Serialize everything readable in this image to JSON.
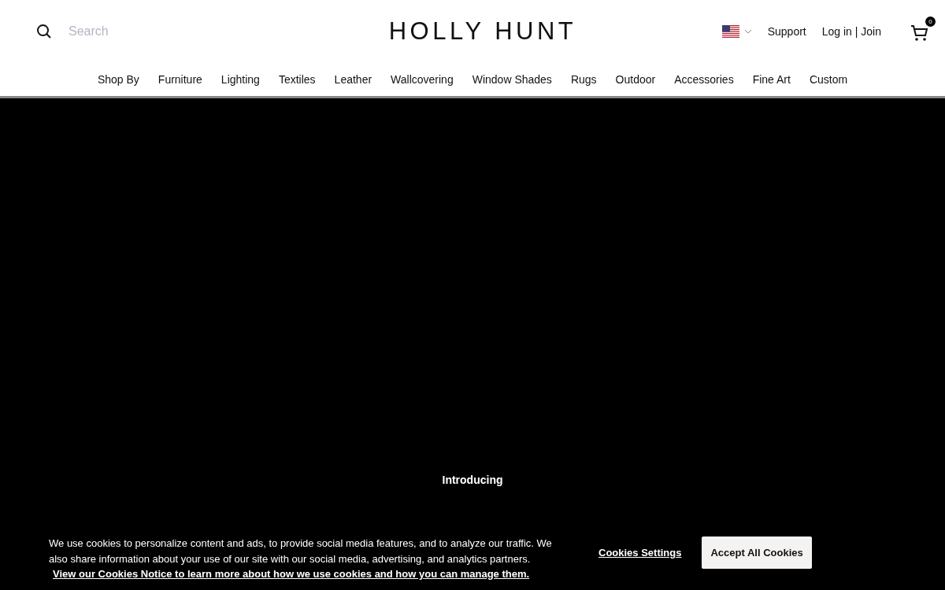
{
  "header": {
    "search": {
      "placeholder": "Search"
    },
    "logo": "HOLLY HUNT",
    "links": [
      "Support",
      "Log in | Join"
    ],
    "cart_count": "0"
  },
  "nav": [
    "Shop By",
    "Furniture",
    "Lighting",
    "Textiles",
    "Leather",
    "Wallcovering",
    "Window Shades",
    "Rugs",
    "Outdoor",
    "Accessories",
    "Fine Art",
    "Custom"
  ],
  "hero": {
    "eyebrow": "Introducing"
  },
  "cookie_banner": {
    "text": "We use cookies to personalize content and ads, to provide social media features, and to analyze our traffic. We also share information about your use of our site with our social media, advertising, and analytics partners.",
    "link": "View our Cookies Notice to learn more about how we use cookies and how you can manage them.",
    "buttons": [
      {
        "label": "Cookies Settings",
        "kind": "link"
      },
      {
        "label": "Accept All Cookies",
        "kind": "primary"
      }
    ]
  }
}
